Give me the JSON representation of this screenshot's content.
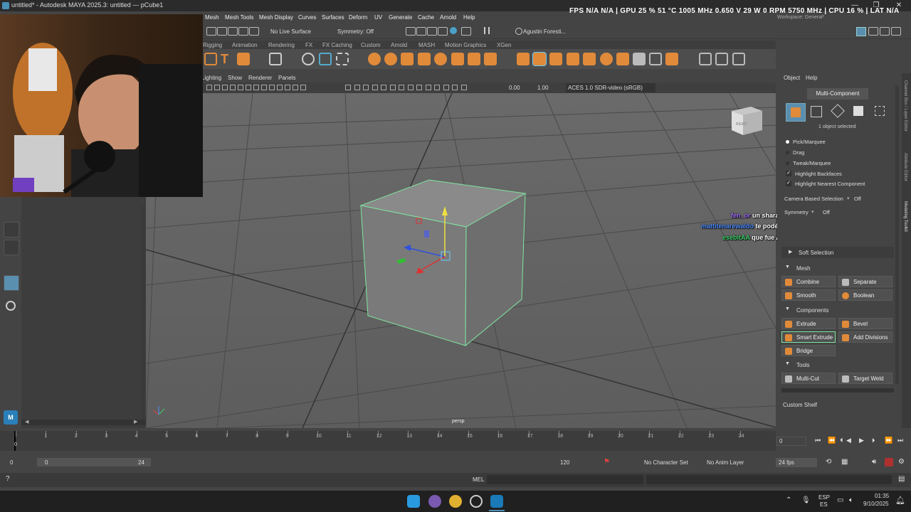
{
  "window": {
    "title": "untitled* - Autodesk MAYA 2025.3: untitled   ---   pCube1",
    "minimize": "—",
    "maximize": "❐",
    "close": "✕"
  },
  "menubar": {
    "items": [
      "Mesh",
      "Mesh Tools",
      "Mesh Display",
      "Curves",
      "Surfaces",
      "Deform",
      "UV",
      "Generate",
      "Cache",
      "Arnold",
      "Help"
    ],
    "workspace": "Workspace: General*"
  },
  "hud": {
    "text": "FPS  N/A  N/A   |   GPU  25 %  51 °C  1005 MHz  0.650 V  29 W  0 RPM  5750 MHz  |   CPU  16 %   |   LAT  N/A"
  },
  "statusline": {
    "live_surface": "No Live Surface",
    "symmetry": "Symmetry: Off",
    "user": "Agustin Foresti..."
  },
  "shelf": {
    "tabs": [
      "Rigging",
      "Animation",
      "Rendering",
      "FX",
      "FX Caching",
      "Custom",
      "Arnold",
      "MASH",
      "Motion Graphics",
      "XGen"
    ]
  },
  "viewport": {
    "menus": [
      "Lighting",
      "Show",
      "Renderer",
      "Panels"
    ],
    "exposure": "0.00",
    "gamma": "1.00",
    "colorspace": "ACES 1.0 SDR-video (sRGB)",
    "camera_label": "persp",
    "viewcube_label": "RIGHT"
  },
  "chat": [
    {
      "user": "fen_or",
      "message": "un sharau a maya",
      "color": "#a070ff"
    },
    {
      "user": "mattitenarewaldo",
      "message": "te podés hacer una buena gótica de anime",
      "color": "#4a8cff"
    },
    {
      "user": "esebitAA",
      "message": "que fue Agus lo que más te costó modelar",
      "color": "#3ccf6a"
    }
  ],
  "rightpanel": {
    "menus": [
      "Object",
      "Help"
    ],
    "mode_button": "Multi-Component",
    "selection_info": "1 object selected",
    "tools": [
      "Pick/Marquee",
      "Drag",
      "Tweak/Marquee"
    ],
    "checks": [
      "Highlight Backfaces",
      "Highlight Nearest Component"
    ],
    "camera_based_label": "Camera Based Selection",
    "camera_based_value": "Off",
    "symmetry_label": "Symmetry",
    "symmetry_value": "Off",
    "soft_selection": "Soft Selection",
    "sections": {
      "mesh": "Mesh",
      "components": "Components",
      "tools": "Tools"
    },
    "mesh_buttons": [
      "Combine",
      "Separate",
      "Smooth",
      "Boolean"
    ],
    "component_buttons": [
      "Extrude",
      "Bevel",
      "Smart Extrude",
      "Add Divisions",
      "Bridge"
    ],
    "tool_buttons": [
      "Multi-Cut",
      "Target Weld"
    ],
    "custom_shelf": "Custom Shelf",
    "side_tabs": [
      "Channel Box / Layer Editor",
      "Attribute Editor",
      "Modeling Toolkit"
    ]
  },
  "timeline": {
    "ticks": [
      "0",
      "1",
      "2",
      "3",
      "4",
      "5",
      "6",
      "7",
      "8",
      "9",
      "10",
      "11",
      "12",
      "13",
      "14",
      "15",
      "16",
      "17",
      "18",
      "19",
      "20",
      "21",
      "22",
      "23",
      "24"
    ],
    "current_frame": "0",
    "current_field": "0",
    "range_start": "0",
    "range_inner_start": "0",
    "range_inner_end": "24",
    "range_end": "120",
    "character_set": "No Character Set",
    "anim_layer": "No Anim Layer",
    "fps": "24 fps"
  },
  "cmdline": {
    "label": "MEL"
  },
  "taskbar": {
    "lang": "ESP",
    "lang2": "ES",
    "time": "01:35",
    "date": "9/10/2025"
  },
  "colors": {
    "accent": "#4a90b8",
    "selection_green": "#7fe5a0",
    "record_red": "#e04040"
  }
}
